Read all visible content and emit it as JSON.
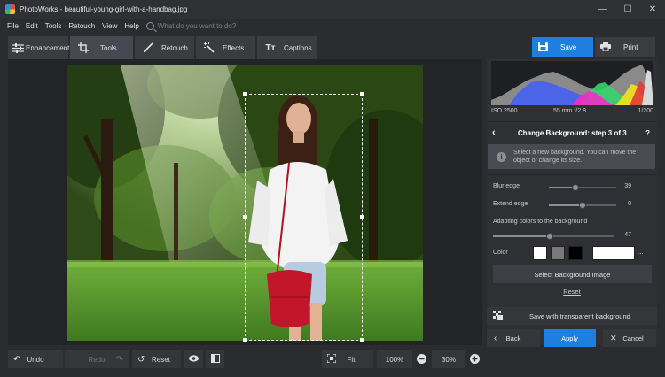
{
  "window": {
    "title": "PhotoWorks - beautiful-young-girl-with-a-handbag.jpg",
    "minimize": "—",
    "maximize": "☐",
    "close": "✕"
  },
  "menu": {
    "items": [
      "File",
      "Edit",
      "Tools",
      "Retouch",
      "View",
      "Help"
    ],
    "search_placeholder": "What do you want to do?"
  },
  "tabs": [
    {
      "label": "Enhancement"
    },
    {
      "label": "Tools",
      "active": true
    },
    {
      "label": "Retouch"
    },
    {
      "label": "Effects"
    },
    {
      "label": "Captions"
    }
  ],
  "toolbar": {
    "save_label": "Save",
    "print_label": "Print",
    "accent": "#1f7fe0"
  },
  "exif": {
    "iso": "ISO 2500",
    "lens": "55 mm f/2.8",
    "shutter": "1/200"
  },
  "panel": {
    "step_title": "Change Background: step 3 of 3",
    "help": "?",
    "info": "Select a new background. You can move the object or change its size.",
    "sliders": {
      "blur": {
        "label": "Blur edge",
        "value": "39",
        "fraction": 0.39
      },
      "extend": {
        "label": "Extend edge",
        "value": "0",
        "fraction": 0.5
      },
      "adapt": {
        "label": "Adapting colors to the background",
        "value": "47",
        "fraction": 0.47
      }
    },
    "color_label": "Color",
    "swatches": [
      "#ffffff",
      "#7a7a7a",
      "#000000",
      "#ffffff"
    ],
    "more": "...",
    "select_bg": "Select Background Image",
    "reset": "Reset",
    "save_transparent": "Save with transparent background",
    "back": "Back",
    "apply": "Apply",
    "cancel": "Cancel"
  },
  "bottom": {
    "undo": "Undo",
    "redo": "Redo",
    "reset": "Reset",
    "fit": "Fit",
    "zoom_full": "100%",
    "zoom": "30%"
  }
}
